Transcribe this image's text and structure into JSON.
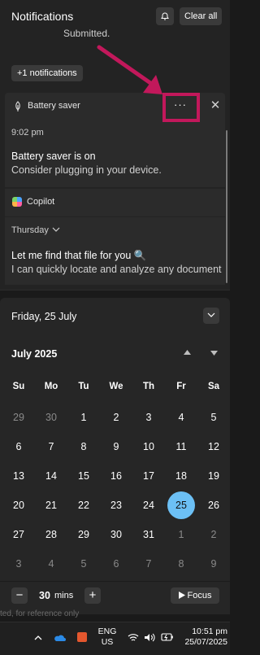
{
  "notifications": {
    "title": "Notifications",
    "clear_all": "Clear all",
    "clipped_text": "Submitted.",
    "more_notifs": "+1 notifications",
    "battery": {
      "app_name": "Battery saver",
      "more_label": "···",
      "close_label": "✕",
      "time": "9:02 pm",
      "title": "Battery saver is on",
      "body": "Consider plugging in your device."
    },
    "copilot": {
      "app_name": "Copilot",
      "day": "Thursday",
      "title": "Let me find that file for you 🔍",
      "body": "I can quickly locate and analyze any document"
    }
  },
  "calendar": {
    "date_header": "Friday, 25 July",
    "month_label": "July 2025",
    "weekdays": [
      "Su",
      "Mo",
      "Tu",
      "We",
      "Th",
      "Fr",
      "Sa"
    ],
    "weeks": [
      [
        [
          "29",
          0
        ],
        [
          "30",
          0
        ],
        [
          "1",
          1
        ],
        [
          "2",
          1
        ],
        [
          "3",
          1
        ],
        [
          "4",
          1
        ],
        [
          "5",
          1
        ]
      ],
      [
        [
          "6",
          1
        ],
        [
          "7",
          1
        ],
        [
          "8",
          1
        ],
        [
          "9",
          1
        ],
        [
          "10",
          1
        ],
        [
          "11",
          1
        ],
        [
          "12",
          1
        ]
      ],
      [
        [
          "13",
          1
        ],
        [
          "14",
          1
        ],
        [
          "15",
          1
        ],
        [
          "16",
          1
        ],
        [
          "17",
          1
        ],
        [
          "18",
          1
        ],
        [
          "19",
          1
        ]
      ],
      [
        [
          "20",
          1
        ],
        [
          "21",
          1
        ],
        [
          "22",
          1
        ],
        [
          "23",
          1
        ],
        [
          "24",
          1
        ],
        [
          "25",
          2
        ],
        [
          "26",
          1
        ]
      ],
      [
        [
          "27",
          1
        ],
        [
          "28",
          1
        ],
        [
          "29",
          1
        ],
        [
          "30",
          1
        ],
        [
          "31",
          1
        ],
        [
          "1",
          0
        ],
        [
          "2",
          0
        ]
      ],
      [
        [
          "3",
          0
        ],
        [
          "4",
          0
        ],
        [
          "5",
          0
        ],
        [
          "6",
          0
        ],
        [
          "7",
          0
        ],
        [
          "8",
          0
        ],
        [
          "9",
          0
        ]
      ]
    ],
    "today_color": "#6cc0f5"
  },
  "focus": {
    "minus": "−",
    "value": "30",
    "unit": "mins",
    "plus": "+",
    "button": "Focus"
  },
  "watermark": "ted, for reference only",
  "taskbar": {
    "lang_line1": "ENG",
    "lang_line2": "US",
    "time": "10:51 pm",
    "date": "25/07/2025"
  },
  "annotation_color": "#c2185b"
}
